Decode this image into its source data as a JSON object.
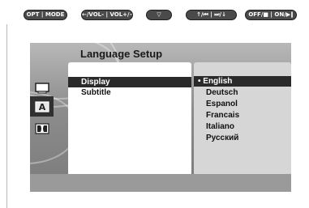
{
  "remote_keys": [
    {
      "name": "opt-mode-key",
      "label": "OPT | MODE"
    },
    {
      "name": "volume-key",
      "label": "←/VOL- | VOL+/→"
    },
    {
      "name": "down-key",
      "label": "▽"
    },
    {
      "name": "up-skip-key",
      "label": "↑/⏮ | ⏭/↓"
    },
    {
      "name": "power-play-key",
      "label": "OFF/■ | ON/▶‖"
    }
  ],
  "screen": {
    "title": "Language Setup",
    "menu": [
      "Display",
      "Subtitle"
    ],
    "selected_menu": "Display",
    "options": [
      "• English",
      "Deutsch",
      "Espanol",
      "Francais",
      "Italiano",
      "Русский"
    ],
    "selected_option": "English",
    "side_icons": [
      "monitor-icon",
      "language-a-icon",
      "dolby-audio-icon"
    ],
    "active_icon": "language-a-icon"
  }
}
